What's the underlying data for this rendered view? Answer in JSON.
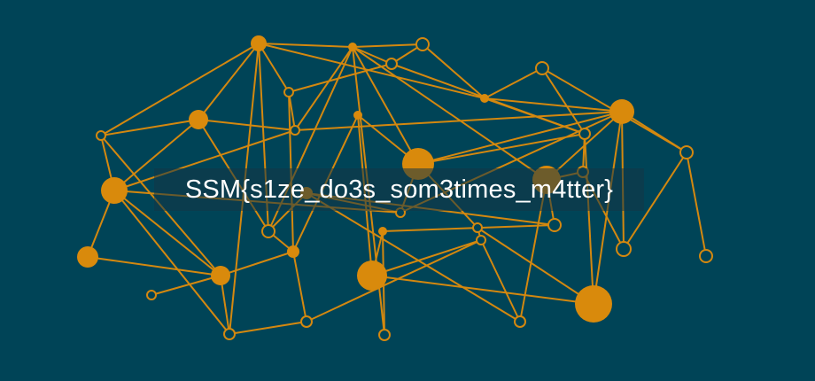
{
  "banner": {
    "text": "SSM{s1ze_do3s_som3times_m4tter}"
  },
  "colors": {
    "background": "#004457",
    "accent": "#d98a0c",
    "text": "#ffffff"
  }
}
